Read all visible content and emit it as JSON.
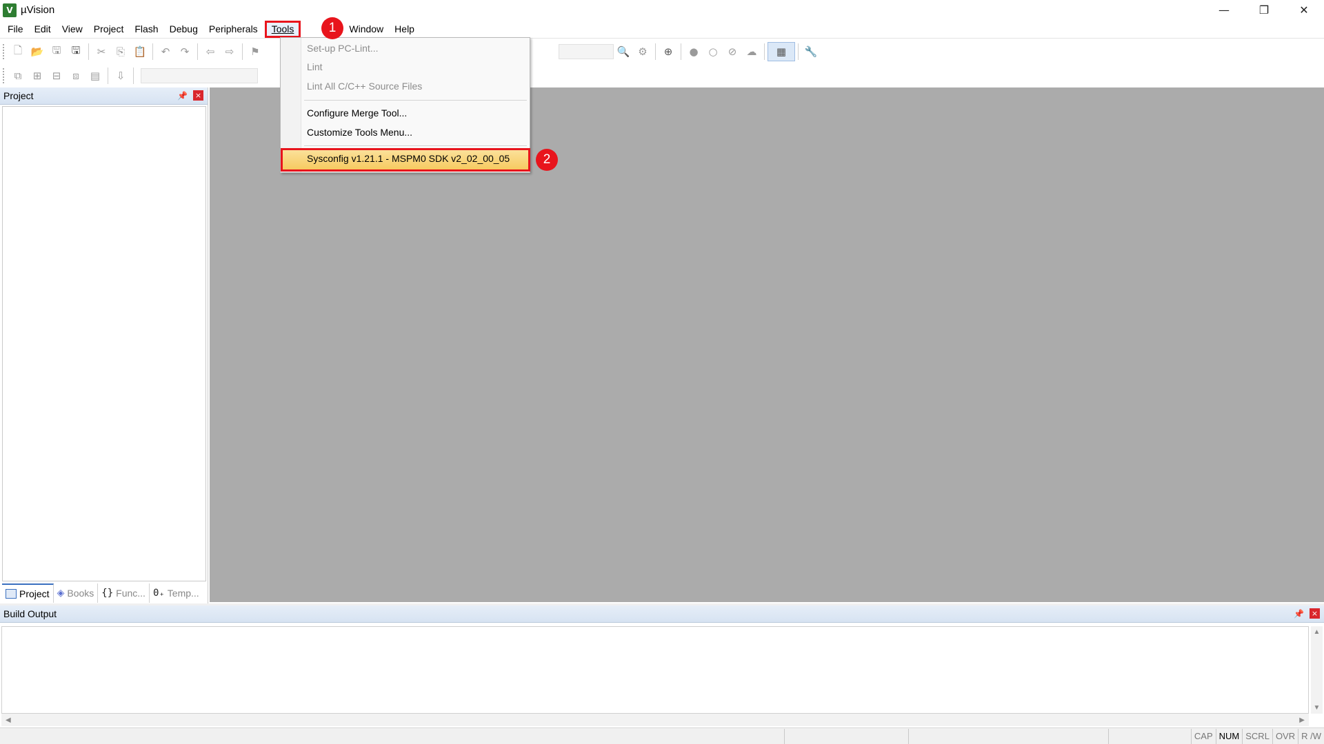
{
  "window": {
    "title": "µVision",
    "icon_label": "V",
    "controls": {
      "minimize": "—",
      "restore": "❐",
      "close": "✕"
    }
  },
  "menubar": {
    "items": [
      "File",
      "Edit",
      "View",
      "Project",
      "Flash",
      "Debug",
      "Peripherals",
      "Tools",
      "Window",
      "Help"
    ]
  },
  "tools_menu": {
    "items": [
      {
        "label": "Set-up PC-Lint...",
        "enabled": false
      },
      {
        "label": "Lint",
        "enabled": false
      },
      {
        "label": "Lint All C/C++ Source Files",
        "enabled": false
      },
      {
        "label": "Configure Merge Tool...",
        "enabled": true
      },
      {
        "label": "Customize Tools Menu...",
        "enabled": true
      },
      {
        "label": "Sysconfig v1.21.1 - MSPM0 SDK v2_02_00_05",
        "enabled": true,
        "highlighted": true
      }
    ]
  },
  "callouts": {
    "step1": "1",
    "step2": "2",
    "color": "#e8141c"
  },
  "project_pane": {
    "title": "Project",
    "pin_icon": "📌",
    "close_icon": "×",
    "tabs": [
      {
        "label": "Project",
        "active": true
      },
      {
        "label": "Books",
        "active": false
      },
      {
        "label": "Func...",
        "active": false,
        "glyph": "{}"
      },
      {
        "label": "Temp...",
        "active": false,
        "glyph": "0₊"
      }
    ]
  },
  "build_output": {
    "title": "Build Output"
  },
  "statusbar": {
    "segments": [
      "CAP",
      "NUM",
      "SCRL",
      "OVR",
      "R /W"
    ],
    "active": [
      "NUM"
    ]
  },
  "colors": {
    "workspace": "#ababab",
    "highlight": "#f6c85a",
    "accent": "#e8141c"
  }
}
